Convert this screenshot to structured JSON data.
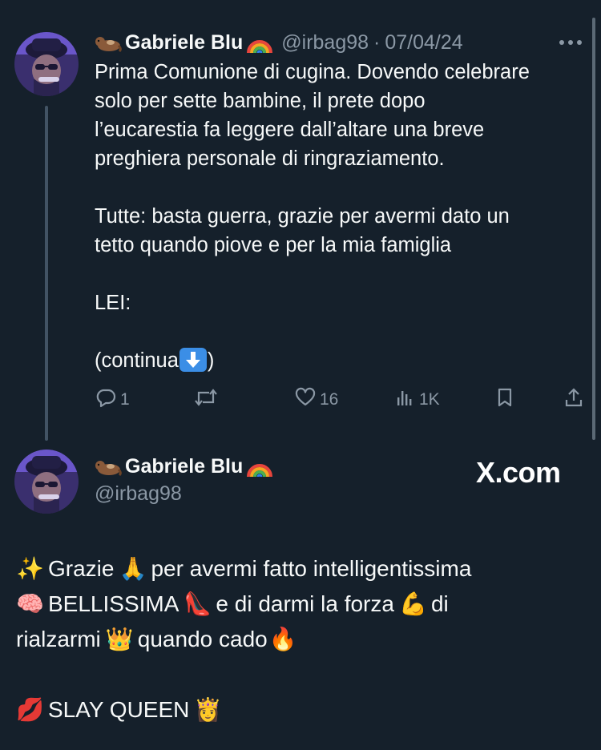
{
  "tweet1": {
    "name": "Gabriele Blu",
    "handle": "@irbag98",
    "separator": "·",
    "date": "07/04/24",
    "text_lines": [
      "Prima Comunione di cugina. Dovendo celebrare",
      "solo per sette bambine, il prete dopo",
      "l’eucarestia fa leggere dall’altare una breve",
      "preghiera personale di ringraziamento.",
      "",
      "Tutte: basta guerra, grazie per avermi dato un",
      "tetto quando piove e per la mia famiglia",
      "",
      "LEI:",
      "",
      "(continua",
      ")"
    ],
    "actions": {
      "replies": "1",
      "retweets": "",
      "likes": "16",
      "views": "1K"
    },
    "icons": {
      "name_emoji_left": "otter-emoji",
      "name_emoji_right": "rainbow-emoji",
      "continua_emoji": "down-arrow-emoji",
      "more": "more-icon",
      "reply": "reply-icon",
      "retweet": "retweet-icon",
      "like": "heart-icon",
      "views": "views-icon",
      "bookmark": "bookmark-icon",
      "share": "share-icon"
    }
  },
  "tweet2": {
    "name": "Gabriele Blu",
    "handle": "@irbag98",
    "watermark": "X.com",
    "lines": [
      {
        "segments": [
          "✨",
          "Grazie",
          "🙏",
          "per avermi fatto intelligentissima"
        ]
      },
      {
        "segments": [
          "🧠",
          "BELLISSIMA",
          "👠",
          "e di darmi la forza",
          "💪",
          "di"
        ]
      },
      {
        "segments": [
          "rialzarmi",
          "👑",
          "quando cado",
          "🔥"
        ]
      },
      {
        "segments": []
      },
      {
        "segments": [
          "💋",
          "SLAY QUEEN",
          "👸"
        ]
      }
    ]
  },
  "colors": {
    "background": "#15202b",
    "text": "#f7f9f9",
    "muted": "#8b98a5",
    "thread_line": "#425364"
  }
}
